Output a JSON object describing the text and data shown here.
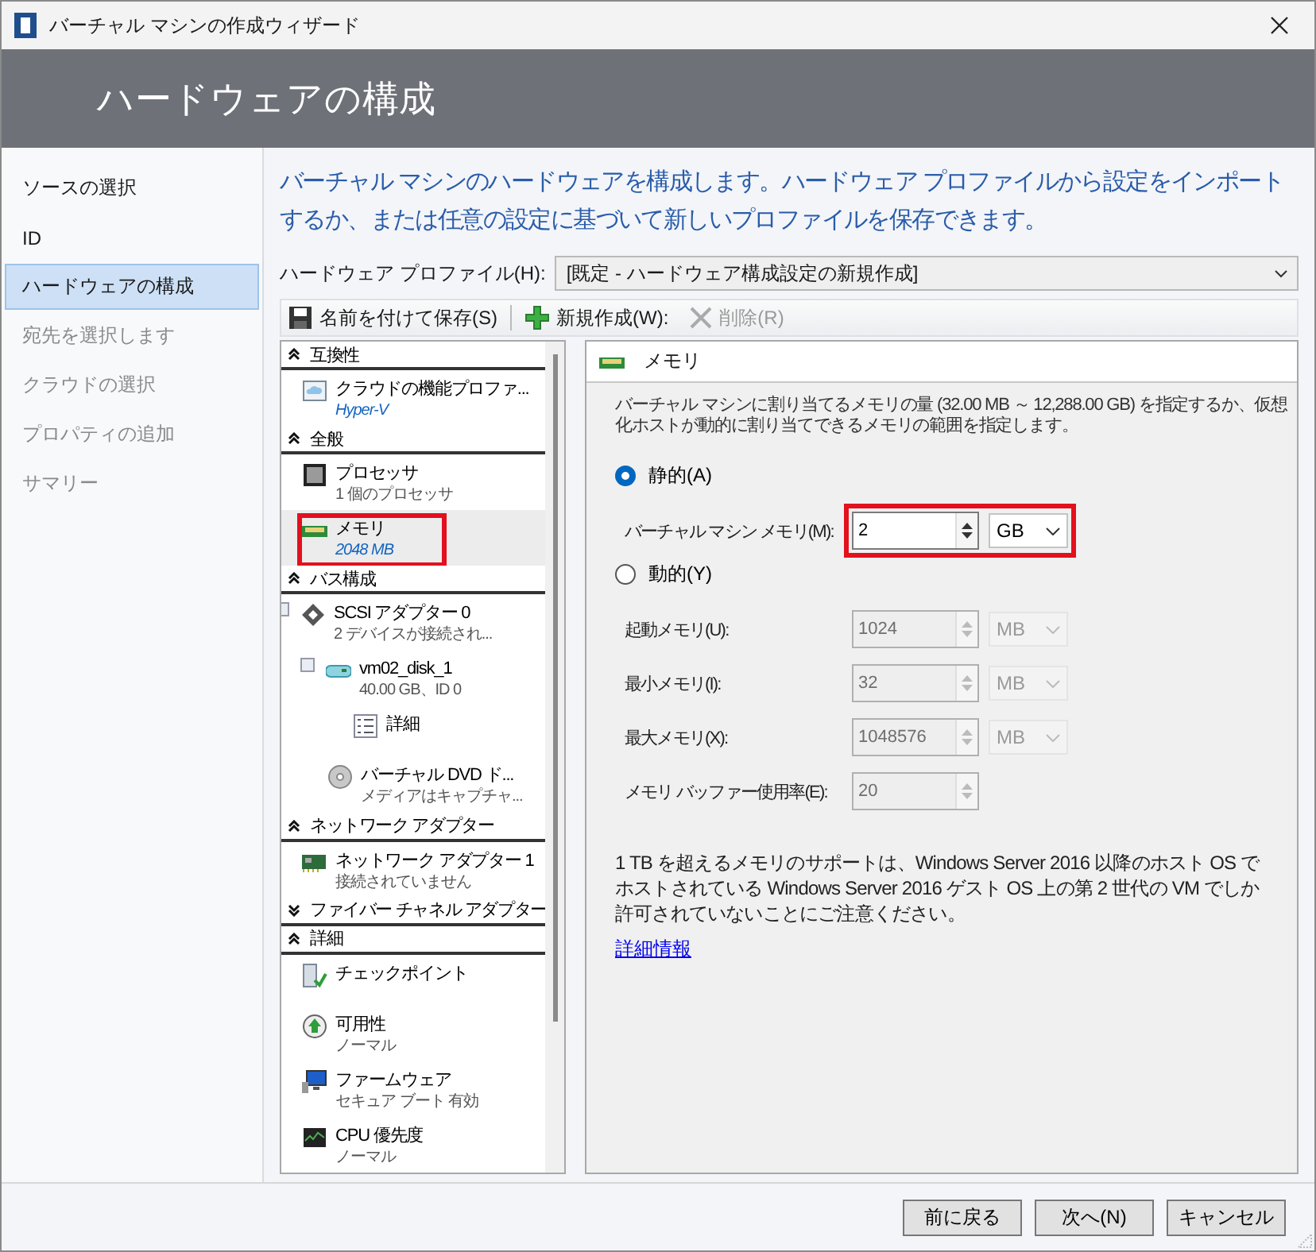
{
  "window": {
    "title": "バーチャル マシンの作成ウィザード"
  },
  "header": {
    "title": "ハードウェアの構成"
  },
  "nav": {
    "items": [
      {
        "label": "ソースの選択",
        "selected": false,
        "disabled": false
      },
      {
        "label": "ID",
        "selected": false,
        "disabled": false
      },
      {
        "label": "ハードウェアの構成",
        "selected": true,
        "disabled": false
      },
      {
        "label": "宛先を選択します",
        "selected": false,
        "disabled": true
      },
      {
        "label": "クラウドの選択",
        "selected": false,
        "disabled": true
      },
      {
        "label": "プロパティの追加",
        "selected": false,
        "disabled": true
      },
      {
        "label": "サマリー",
        "selected": false,
        "disabled": true
      }
    ]
  },
  "intro": "バーチャル マシンのハードウェアを構成します。ハードウェア プロファイルから設定をインポートするか、または任意の設定に基づいて新しいプロファイルを保存できます。",
  "profile": {
    "label": "ハードウェア プロファイル(H):",
    "value": "[既定 - ハードウェア構成設定の新規作成]"
  },
  "toolbar": [
    {
      "label": "名前を付けて保存(S)",
      "disabled": false
    },
    {
      "label": "新規作成(W):",
      "disabled": false
    },
    {
      "label": "削除(R)",
      "disabled": true
    }
  ],
  "tree": {
    "sections": [
      {
        "title": "互換性",
        "expanded": true,
        "items": [
          {
            "kind": "cloud",
            "name": "クラウドの機能プロファ...",
            "detail": "Hyper-V",
            "selected": false,
            "highlighted": false
          }
        ]
      },
      {
        "title": "全般",
        "expanded": true,
        "items": [
          {
            "kind": "cpu",
            "name": "プロセッサ",
            "detail": "1 個のプロセッサ",
            "selected": false,
            "highlighted": false
          },
          {
            "kind": "memory",
            "name": "メモリ",
            "detail": "2048 MB",
            "selected": true,
            "highlighted": true
          }
        ]
      },
      {
        "title": "バス構成",
        "expanded": true,
        "items": [
          {
            "kind": "scsi",
            "name": "SCSI アダプター 0",
            "detail": "2 デバイスが接続され...",
            "selected": false,
            "highlighted": false,
            "children": [
              {
                "kind": "disk",
                "name": "vm02_disk_1",
                "detail": "40.00 GB、ID 0",
                "selected": false,
                "highlighted": false,
                "children": [
                  {
                    "kind": "details",
                    "name": "詳細",
                    "selected": false,
                    "highlighted": false
                  }
                ]
              },
              {
                "kind": "dvd",
                "name": "バーチャル DVD ド...",
                "detail": "メディアはキャプチャ...",
                "selected": false,
                "highlighted": false
              }
            ]
          }
        ]
      },
      {
        "title": "ネットワーク アダプター",
        "expanded": true,
        "items": [
          {
            "kind": "nic",
            "name": "ネットワーク アダプター 1",
            "detail": "接続されていません",
            "selected": false,
            "highlighted": false
          }
        ]
      },
      {
        "title": "ファイバー チャネル アダプター",
        "expanded": false
      },
      {
        "title": "詳細",
        "expanded": true,
        "items": [
          {
            "kind": "checkpoint",
            "name": "チェックポイント",
            "selected": false,
            "highlighted": false
          },
          {
            "kind": "availability",
            "name": "可用性",
            "detail": "ノーマル",
            "selected": false,
            "highlighted": false
          },
          {
            "kind": "firmware",
            "name": "ファームウェア",
            "detail": "セキュア ブート 有効",
            "selected": false,
            "highlighted": false
          },
          {
            "kind": "priority",
            "name": "CPU 優先度",
            "detail": "ノーマル",
            "selected": false,
            "highlighted": false
          }
        ]
      }
    ]
  },
  "detail": {
    "title": "メモリ",
    "description": "バーチャル マシンに割り当てるメモリの量 (32.00 MB ～ 12,288.00 GB) を指定するか、仮想化ホストが動的に割り当てできるメモリの範囲を指定します。",
    "options": [
      {
        "label": "静的(A)",
        "selected": true,
        "fields": [
          {
            "label": "バーチャル マシン メモリ(M):",
            "value": "2",
            "unit": "GB",
            "disabled": false,
            "highlighted": true
          }
        ]
      },
      {
        "label": "動的(Y)",
        "selected": false,
        "fields": [
          {
            "label": "起動メモリ(U):",
            "value": "1024",
            "unit": "MB",
            "disabled": true
          },
          {
            "label": "最小メモリ(I):",
            "value": "32",
            "unit": "MB",
            "disabled": true
          },
          {
            "label": "最大メモリ(X):",
            "value": "1048576",
            "unit": "MB",
            "disabled": true
          },
          {
            "label": "メモリ バッファー使用率(E):",
            "value": "20",
            "disabled": true
          }
        ]
      }
    ],
    "note": "1 TB を超えるメモリのサポートは、Windows Server 2016 以降のホスト OS でホストされている Windows Server 2016 ゲスト OS 上の第 2 世代の VM でしか許可されていないことにご注意ください。",
    "link": "詳細情報"
  },
  "buttons": [
    "前に戻る",
    "次へ(N)",
    "キャンセル"
  ]
}
